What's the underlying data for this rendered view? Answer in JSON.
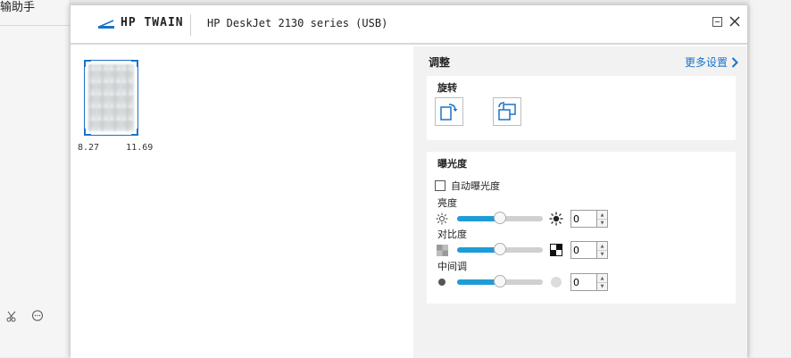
{
  "background_app": {
    "title_fragment": "输助手",
    "icons": [
      "scissors-icon",
      "chat-bubble-icon"
    ]
  },
  "dialog": {
    "brand": "HP TWAIN",
    "device": "HP DeskJet 2130 series (USB)",
    "preview": {
      "size_label": "8.27     11.69"
    },
    "panel": {
      "header": "调整",
      "more_settings": "更多设置",
      "more_icon": "chevron-right-icon",
      "rotate": {
        "title": "旋转",
        "buttons": [
          {
            "name": "rotate-left-icon"
          },
          {
            "name": "rotate-right-icon"
          }
        ]
      },
      "exposure": {
        "title": "曝光度",
        "auto_label": "自动曝光度",
        "auto_checked": false,
        "sliders": [
          {
            "label": "亮度",
            "value": "0",
            "level": 0.5
          },
          {
            "label": "对比度",
            "value": "0",
            "level": 0.5
          },
          {
            "label": "中间调",
            "value": "0",
            "level": 0.5
          }
        ]
      }
    }
  },
  "colors": {
    "accent": "#1a73c8",
    "slider_fill": "#1e9cd7",
    "panel_bg": "#f2f2f2"
  }
}
